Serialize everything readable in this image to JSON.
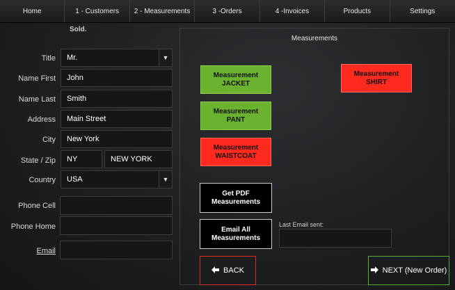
{
  "nav": {
    "items": [
      "Home",
      "1 - Customers",
      "2 - Measurements",
      "3 -Orders",
      "4 -Invoices",
      "Products",
      "Settings"
    ]
  },
  "sold_label": "Sold.",
  "form": {
    "title_label": "Title",
    "title_value": "Mr.",
    "first_label": "Name First",
    "first_value": "John",
    "last_label": "Name Last",
    "last_value": "Smith",
    "address_label": "Address",
    "address_value": "Main Street",
    "city_label": "City",
    "city_value": "New York",
    "statezip_label": "State / Zip",
    "state_value": "NY",
    "zip_value": "NEW YORK",
    "country_label": "Country",
    "country_value": "USA",
    "phone_cell_label": "Phone Cell",
    "phone_cell_value": "",
    "phone_home_label": "Phone Home",
    "phone_home_value": "",
    "email_label": "Email",
    "email_value": ""
  },
  "measurements": {
    "title": "Measurements",
    "jacket": {
      "line1": "Measurement",
      "line2": "JACKET"
    },
    "pant": {
      "line1": "Measurement",
      "line2": "PANT"
    },
    "waistcoat": {
      "line1": "Measurement",
      "line2": "WAISTCOAT"
    },
    "shirt": {
      "line1": "Measurement",
      "line2": "SHIRT"
    },
    "pdf": {
      "line1": "Get PDF",
      "line2": "Measurements"
    },
    "email_all": {
      "line1": "Email All",
      "line2": "Measurements"
    },
    "last_email_label": "Last Email sent:",
    "last_email_value": "",
    "back_label": "BACK",
    "next_label": "NEXT (New Order)"
  },
  "colors": {
    "green": "#6ab22f",
    "red": "#ff2a1f",
    "back_border": "#e02a22",
    "next_border": "#5fa83a"
  },
  "icons": {
    "select": "triangle-down-icon",
    "back": "arrow-left-icon",
    "next": "arrow-right-icon"
  }
}
